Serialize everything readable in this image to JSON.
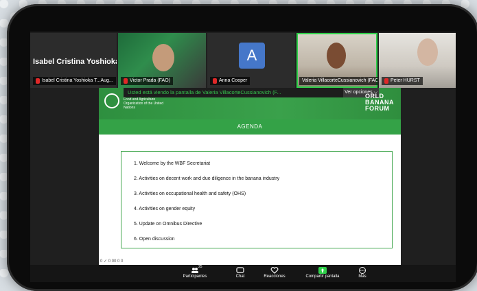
{
  "participants": [
    {
      "display_name": "Isabel Cristina Yoshioka ...",
      "label": "Isabel Cristina Yoshioka T...Aug..."
    },
    {
      "label": "Victor Prada (FAO)"
    },
    {
      "avatar_letter": "A",
      "label": "Anna Cooper"
    },
    {
      "label": "Valeria VillacorteCussianovich (FAO)"
    },
    {
      "label": "Peter HURST"
    }
  ],
  "share": {
    "banner": "Usted está viendo la pantalla de  Valeria VillacorteCussianovich (F...",
    "view_options": "Ver opciones",
    "org_text": "Food and Agriculture Organization of the United Nations",
    "wbf_lines": [
      "ORLD",
      "BANANA",
      "FORUM"
    ],
    "agenda_title": "AGENDA",
    "agenda_items": [
      "1.  Welcome by the WBF Secretariat",
      "2.  Activities on decent work and due diligence in the banana industry",
      "3.  Activities on occupational health and safety (OHS)",
      "4.  Activities on gender equity",
      "5.  Update on Omnibus Directive",
      "6.  Open discussion"
    ],
    "footer": "0 ✓ 0 00 0 0"
  },
  "toolbar": {
    "participants_count": "25",
    "participants": "Participantes",
    "chat": "Chat",
    "reactions": "Reacciones",
    "share_screen": "Compartir pantalla",
    "more": "Más"
  },
  "colors": {
    "brand_green": "#34a247",
    "banner_text": "#35c24d",
    "mic_muted": "#e02828"
  }
}
